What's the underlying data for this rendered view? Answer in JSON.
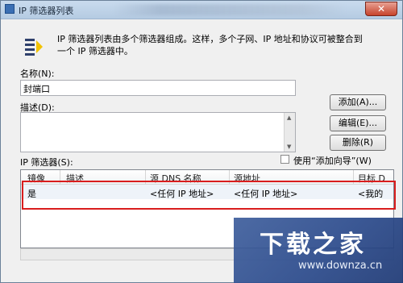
{
  "window": {
    "title": "IP 筛选器列表",
    "close_glyph": "✕"
  },
  "intro_text": "IP 筛选器列表由多个筛选器组成。这样，多个子网、IP 地址和协议可被整合到一个 IP 筛选器中。",
  "name_label": "名称(N):",
  "name_value": "封端口",
  "desc_label": "描述(D):",
  "desc_value": "",
  "buttons": {
    "add": "添加(A)...",
    "edit": "编辑(E)...",
    "remove": "删除(R)"
  },
  "filters_label": "IP 筛选器(S):",
  "wizard_checkbox": {
    "label": "使用“添加向导”(W)",
    "checked": false
  },
  "table": {
    "headers": [
      "镜像",
      "描述",
      "源 DNS 名称",
      "源地址",
      "目标 D"
    ],
    "rows": [
      [
        "是",
        "",
        "<任何 IP 地址>",
        "<任何 IP 地址>",
        "<我的"
      ]
    ]
  },
  "watermark": {
    "title": "下载之家",
    "url": "www.downza.cn"
  },
  "colors": {
    "highlight_border": "#d91d1d",
    "watermark_bg": "#2c4b8c"
  },
  "icons": [
    "filter-list-icon",
    "window-icon",
    "close-icon"
  ]
}
